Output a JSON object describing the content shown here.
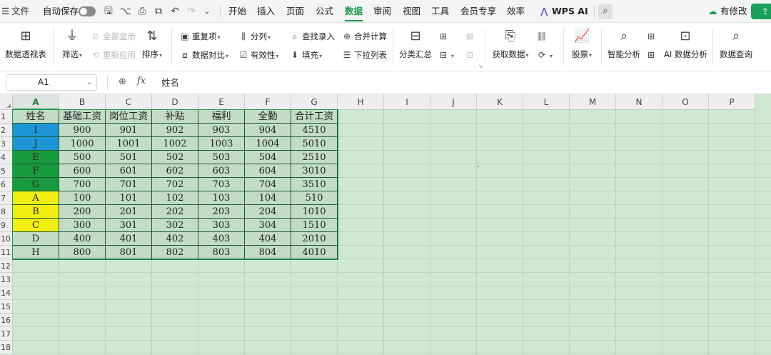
{
  "menubar": {
    "file": "文件",
    "autosave": "自动保存",
    "tabs": [
      "开始",
      "插入",
      "页面",
      "公式",
      "数据",
      "审阅",
      "视图",
      "工具",
      "会员专享",
      "效率"
    ],
    "active_tab": "数据",
    "wps_ai": "WPS AI",
    "has_changes": "有修改"
  },
  "ribbon": {
    "pivot": "数据透视表",
    "filter": "筛选",
    "show_all": "全部显示",
    "reapply": "重新应用",
    "sort": "排序",
    "duplicates": "重复项",
    "compare": "数据对比",
    "split": "分列",
    "validity": "有效性",
    "find_entry": "查找录入",
    "fill": "填充",
    "consolidate": "合并计算",
    "dropdown": "下拉列表",
    "subtotal": "分类汇总",
    "get_data": "获取数据",
    "stocks": "股票",
    "smart_analysis": "智能分析",
    "ai_analysis": "AI 数据分析",
    "data_query": "数据查询"
  },
  "formula_bar": {
    "cell_ref": "A1",
    "content": "姓名"
  },
  "columns": [
    "A",
    "B",
    "C",
    "D",
    "E",
    "F",
    "G",
    "H",
    "I",
    "J",
    "K",
    "L",
    "M",
    "N",
    "O",
    "P"
  ],
  "rows": [
    "1",
    "2",
    "3",
    "4",
    "5",
    "6",
    "7",
    "8",
    "9",
    "10",
    "11",
    "12",
    "13",
    "14",
    "15",
    "16",
    "17",
    "18"
  ],
  "table": {
    "headers": [
      "姓名",
      "基础工资",
      "岗位工资",
      "补贴",
      "福利",
      "全勤",
      "合计工资"
    ],
    "rows": [
      [
        "I",
        "900",
        "901",
        "902",
        "903",
        "904",
        "4510"
      ],
      [
        "J",
        "1000",
        "1001",
        "1002",
        "1003",
        "1004",
        "5010"
      ],
      [
        "E",
        "500",
        "501",
        "502",
        "503",
        "504",
        "2510"
      ],
      [
        "F",
        "600",
        "601",
        "602",
        "603",
        "604",
        "3010"
      ],
      [
        "G",
        "700",
        "701",
        "702",
        "703",
        "704",
        "3510"
      ],
      [
        "A",
        "100",
        "101",
        "102",
        "103",
        "104",
        "510"
      ],
      [
        "B",
        "200",
        "201",
        "202",
        "203",
        "204",
        "1010"
      ],
      [
        "C",
        "300",
        "301",
        "302",
        "303",
        "304",
        "1510"
      ],
      [
        "D",
        "400",
        "401",
        "402",
        "403",
        "404",
        "2010"
      ],
      [
        "H",
        "800",
        "801",
        "802",
        "803",
        "804",
        "4010"
      ]
    ],
    "name_fills": [
      "#1e96d6",
      "#1e96d6",
      "#1a9a3e",
      "#1a9a3e",
      "#1a9a3e",
      "#f2ee11",
      "#f2ee11",
      "#f2ee11",
      "",
      ""
    ]
  },
  "colors": {
    "accent": "#1a9a4a",
    "grid_bg": "#cfe8d2",
    "table_bg": "#c2dcc6",
    "blue_fill": "#1e96d6",
    "green_fill": "#1a9a3e",
    "yellow_fill": "#f2ee11"
  }
}
